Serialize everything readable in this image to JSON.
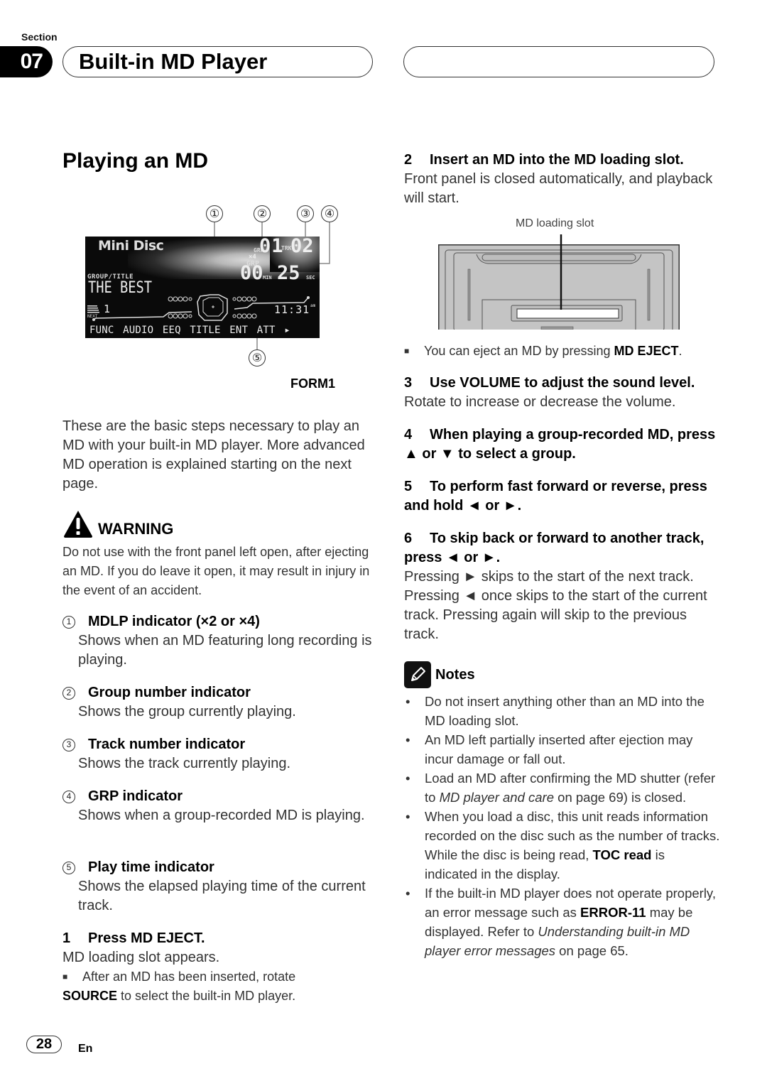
{
  "header": {
    "section_label": "Section",
    "section_number": "07",
    "section_title": "Built-in MD Player"
  },
  "page_title": "Playing an MD",
  "display_figure": {
    "callouts": [
      "①",
      "②",
      "③",
      "④",
      "⑤"
    ],
    "lcd": {
      "brand": "Mini Disc",
      "grp_small": "GRP",
      "mdlp": "×4",
      "group_number": "01",
      "trk_label": "TRK",
      "track_number": "02",
      "grp_indicator": "GRP",
      "minutes": "00",
      "min_label": "MIN",
      "seconds": "25",
      "sec_label": "SEC",
      "group_title_label": "GROUP/TITLE",
      "title": "THE BEST",
      "next_label": "NEXT",
      "next_number": "1",
      "clock": "11:31",
      "am": "am",
      "menu": "FUNC AUDIO EEQ TITLE ENT ATT ▸"
    },
    "caption": "FORM1"
  },
  "intro": "These are the basic steps necessary to play an MD with your built-in MD player. More advanced MD operation is explained starting on the next page.",
  "warning": {
    "label": "WARNING",
    "text": "Do not use with the front panel left open, after ejecting an MD. If you do leave it open, it may result in injury in the event of an accident."
  },
  "indicators": [
    {
      "num": "1",
      "title": "MDLP indicator (×2 or ×4)",
      "desc": "Shows when an MD featuring long recording is playing."
    },
    {
      "num": "2",
      "title": "Group number indicator",
      "desc": "Shows the group currently playing."
    },
    {
      "num": "3",
      "title": "Track number indicator",
      "desc": "Shows the track currently playing."
    },
    {
      "num": "4",
      "title": "GRP indicator",
      "desc": "Shows when a group-recorded MD is playing."
    },
    {
      "num": "5",
      "title": "Play time indicator",
      "desc": "Shows the elapsed playing time of the current track."
    }
  ],
  "steps": [
    {
      "num": "1",
      "title": "Press MD EJECT.",
      "body": "MD loading slot appears.",
      "note_pre": "After an MD has been inserted, rotate",
      "note_bold": "SOURCE",
      "note_post": " to select the built-in MD player."
    },
    {
      "num": "2",
      "title": "Insert an MD into the MD loading slot.",
      "body": "Front panel is closed automatically, and playback will start.",
      "figure_label": "MD loading slot",
      "note_pre": "You can eject an MD by pressing ",
      "note_bold": "MD EJECT",
      "note_post": "."
    },
    {
      "num": "3",
      "title": "Use VOLUME to adjust the sound level.",
      "body": "Rotate to increase or decrease the volume."
    },
    {
      "num": "4",
      "title": "When playing a group-recorded MD, press ▲ or ▼ to select a group."
    },
    {
      "num": "5",
      "title": "To perform fast forward or reverse, press and hold ◄ or ►."
    },
    {
      "num": "6",
      "title": "To skip back or forward to another track, press ◄ or ►.",
      "body": "Pressing ► skips to the start of the next track. Pressing ◄ once skips to the start of the current track. Pressing again will skip to the previous track."
    }
  ],
  "notes": {
    "label": "Notes",
    "items": [
      {
        "pre": "Do not insert anything other than an MD into the MD loading slot."
      },
      {
        "pre": "An MD left partially inserted after ejection may incur damage or fall out."
      },
      {
        "pre": "Load an MD after confirming the MD shutter (refer to ",
        "italic": "MD player and care",
        "post": " on page 69) is closed."
      },
      {
        "pre": "When you load a disc, this unit reads information recorded on the disc such as the number of tracks. While the disc is being read, ",
        "bold": "TOC read",
        "post": " is indicated in the display."
      },
      {
        "pre": "If the built-in MD player does not operate properly, an error message such as ",
        "bold": "ERROR-11",
        "mid": " may be displayed. Refer to ",
        "italic": "Understanding built-in MD player error messages",
        "post": " on page 65."
      }
    ]
  },
  "footer": {
    "page_number": "28",
    "language": "En"
  }
}
